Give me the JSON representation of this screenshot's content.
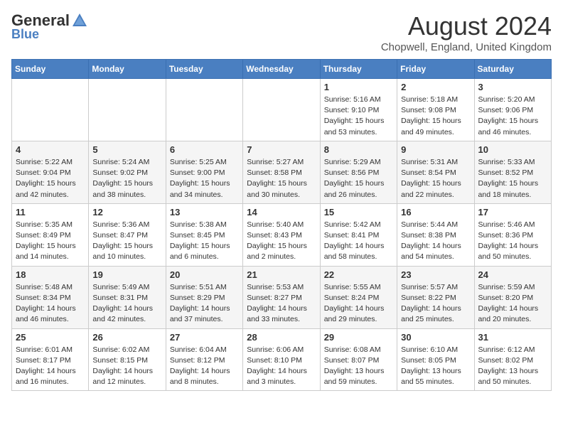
{
  "header": {
    "logo_general": "General",
    "logo_blue": "Blue",
    "month_title": "August 2024",
    "location": "Chopwell, England, United Kingdom"
  },
  "days_of_week": [
    "Sunday",
    "Monday",
    "Tuesday",
    "Wednesday",
    "Thursday",
    "Friday",
    "Saturday"
  ],
  "weeks": [
    {
      "days": [
        {
          "number": "",
          "detail": ""
        },
        {
          "number": "",
          "detail": ""
        },
        {
          "number": "",
          "detail": ""
        },
        {
          "number": "",
          "detail": ""
        },
        {
          "number": "1",
          "detail": "Sunrise: 5:16 AM\nSunset: 9:10 PM\nDaylight: 15 hours\nand 53 minutes."
        },
        {
          "number": "2",
          "detail": "Sunrise: 5:18 AM\nSunset: 9:08 PM\nDaylight: 15 hours\nand 49 minutes."
        },
        {
          "number": "3",
          "detail": "Sunrise: 5:20 AM\nSunset: 9:06 PM\nDaylight: 15 hours\nand 46 minutes."
        }
      ]
    },
    {
      "days": [
        {
          "number": "4",
          "detail": "Sunrise: 5:22 AM\nSunset: 9:04 PM\nDaylight: 15 hours\nand 42 minutes."
        },
        {
          "number": "5",
          "detail": "Sunrise: 5:24 AM\nSunset: 9:02 PM\nDaylight: 15 hours\nand 38 minutes."
        },
        {
          "number": "6",
          "detail": "Sunrise: 5:25 AM\nSunset: 9:00 PM\nDaylight: 15 hours\nand 34 minutes."
        },
        {
          "number": "7",
          "detail": "Sunrise: 5:27 AM\nSunset: 8:58 PM\nDaylight: 15 hours\nand 30 minutes."
        },
        {
          "number": "8",
          "detail": "Sunrise: 5:29 AM\nSunset: 8:56 PM\nDaylight: 15 hours\nand 26 minutes."
        },
        {
          "number": "9",
          "detail": "Sunrise: 5:31 AM\nSunset: 8:54 PM\nDaylight: 15 hours\nand 22 minutes."
        },
        {
          "number": "10",
          "detail": "Sunrise: 5:33 AM\nSunset: 8:52 PM\nDaylight: 15 hours\nand 18 minutes."
        }
      ]
    },
    {
      "days": [
        {
          "number": "11",
          "detail": "Sunrise: 5:35 AM\nSunset: 8:49 PM\nDaylight: 15 hours\nand 14 minutes."
        },
        {
          "number": "12",
          "detail": "Sunrise: 5:36 AM\nSunset: 8:47 PM\nDaylight: 15 hours\nand 10 minutes."
        },
        {
          "number": "13",
          "detail": "Sunrise: 5:38 AM\nSunset: 8:45 PM\nDaylight: 15 hours\nand 6 minutes."
        },
        {
          "number": "14",
          "detail": "Sunrise: 5:40 AM\nSunset: 8:43 PM\nDaylight: 15 hours\nand 2 minutes."
        },
        {
          "number": "15",
          "detail": "Sunrise: 5:42 AM\nSunset: 8:41 PM\nDaylight: 14 hours\nand 58 minutes."
        },
        {
          "number": "16",
          "detail": "Sunrise: 5:44 AM\nSunset: 8:38 PM\nDaylight: 14 hours\nand 54 minutes."
        },
        {
          "number": "17",
          "detail": "Sunrise: 5:46 AM\nSunset: 8:36 PM\nDaylight: 14 hours\nand 50 minutes."
        }
      ]
    },
    {
      "days": [
        {
          "number": "18",
          "detail": "Sunrise: 5:48 AM\nSunset: 8:34 PM\nDaylight: 14 hours\nand 46 minutes."
        },
        {
          "number": "19",
          "detail": "Sunrise: 5:49 AM\nSunset: 8:31 PM\nDaylight: 14 hours\nand 42 minutes."
        },
        {
          "number": "20",
          "detail": "Sunrise: 5:51 AM\nSunset: 8:29 PM\nDaylight: 14 hours\nand 37 minutes."
        },
        {
          "number": "21",
          "detail": "Sunrise: 5:53 AM\nSunset: 8:27 PM\nDaylight: 14 hours\nand 33 minutes."
        },
        {
          "number": "22",
          "detail": "Sunrise: 5:55 AM\nSunset: 8:24 PM\nDaylight: 14 hours\nand 29 minutes."
        },
        {
          "number": "23",
          "detail": "Sunrise: 5:57 AM\nSunset: 8:22 PM\nDaylight: 14 hours\nand 25 minutes."
        },
        {
          "number": "24",
          "detail": "Sunrise: 5:59 AM\nSunset: 8:20 PM\nDaylight: 14 hours\nand 20 minutes."
        }
      ]
    },
    {
      "days": [
        {
          "number": "25",
          "detail": "Sunrise: 6:01 AM\nSunset: 8:17 PM\nDaylight: 14 hours\nand 16 minutes."
        },
        {
          "number": "26",
          "detail": "Sunrise: 6:02 AM\nSunset: 8:15 PM\nDaylight: 14 hours\nand 12 minutes."
        },
        {
          "number": "27",
          "detail": "Sunrise: 6:04 AM\nSunset: 8:12 PM\nDaylight: 14 hours\nand 8 minutes."
        },
        {
          "number": "28",
          "detail": "Sunrise: 6:06 AM\nSunset: 8:10 PM\nDaylight: 14 hours\nand 3 minutes."
        },
        {
          "number": "29",
          "detail": "Sunrise: 6:08 AM\nSunset: 8:07 PM\nDaylight: 13 hours\nand 59 minutes."
        },
        {
          "number": "30",
          "detail": "Sunrise: 6:10 AM\nSunset: 8:05 PM\nDaylight: 13 hours\nand 55 minutes."
        },
        {
          "number": "31",
          "detail": "Sunrise: 6:12 AM\nSunset: 8:02 PM\nDaylight: 13 hours\nand 50 minutes."
        }
      ]
    }
  ]
}
